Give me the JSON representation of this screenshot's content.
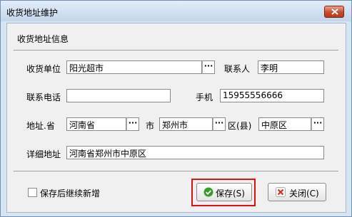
{
  "window": {
    "title": "收货地址维护"
  },
  "section": {
    "title": "收货地址信息"
  },
  "form": {
    "unit_label": "收货单位",
    "unit_value": "阳光超市",
    "contact_label": "联系人",
    "contact_value": "李明",
    "phone_label": "联系电话",
    "phone_value": "",
    "mobile_label": "手机",
    "mobile_value": "15955556666",
    "address_label": "地址.省",
    "province_value": "河南省",
    "city_label": "市",
    "city_value": "郑州市",
    "district_label": "区(县)",
    "district_value": "中原区",
    "detail_label": "详细地址",
    "detail_value": "河南省郑州市中原区",
    "lookup_glyph": "···"
  },
  "footer": {
    "continue_label": "保存后继续新增",
    "continue_checked": false,
    "save_label": "保存(S)",
    "close_label": "关闭(C)"
  },
  "icons": {
    "save": "check-circle-icon",
    "close": "red-x-icon",
    "window_close": "close-icon"
  },
  "colors": {
    "highlight": "#e01010",
    "save_icon": "#3c9a2e",
    "close_icon": "#d62d20"
  }
}
